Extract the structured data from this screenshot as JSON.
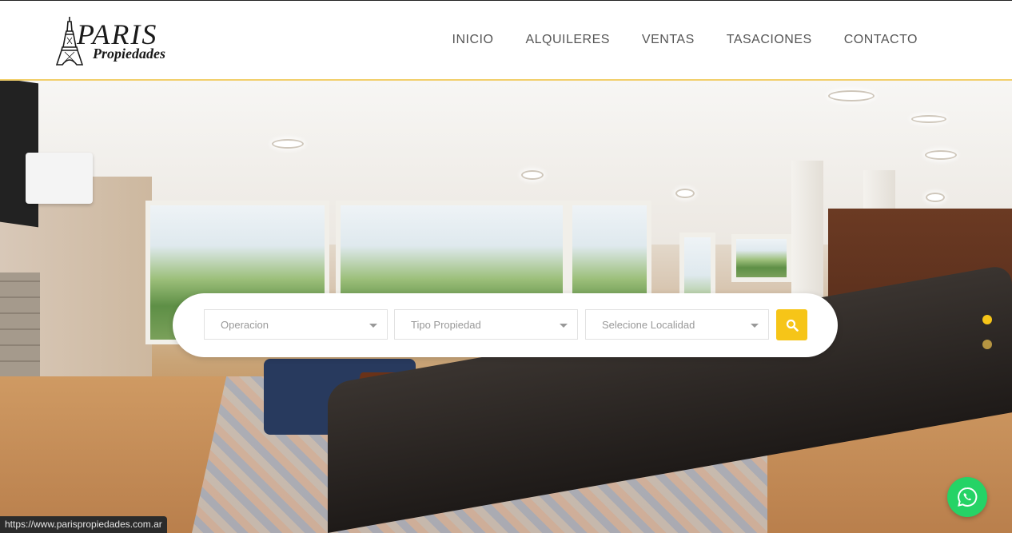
{
  "brand": {
    "title": "PARIS",
    "subtitle": "Propiedades"
  },
  "nav": {
    "items": [
      "INICIO",
      "ALQUILERES",
      "VENTAS",
      "TASACIONES",
      "CONTACTO"
    ]
  },
  "search": {
    "operation_label": "Operacion",
    "type_label": "Tipo Propiedad",
    "location_label": "Selecione Localidad"
  },
  "slider": {
    "dot_count": 2,
    "active_index": 0
  },
  "status_bar": {
    "url": "https://www.parispropiedades.com.ar"
  },
  "colors": {
    "accent": "#f6c518",
    "header_border": "#f2cf6b",
    "whatsapp": "#25d366",
    "nav_text": "#555555"
  },
  "icons": {
    "search": "search-icon",
    "whatsapp": "whatsapp-icon",
    "logo": "eiffel-tower-icon"
  }
}
